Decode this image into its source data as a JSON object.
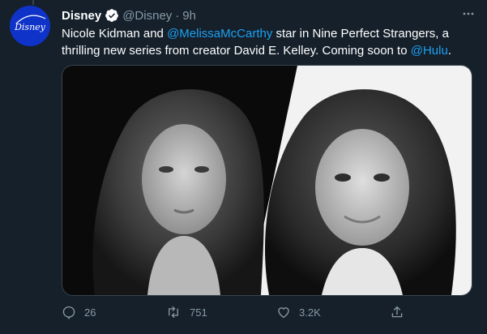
{
  "tweet": {
    "author": {
      "name": "Disney",
      "handle": "@Disney",
      "separator": "·",
      "time": "9h",
      "avatar_logo_text": "Disney",
      "verified_icon": "verified-badge-icon"
    },
    "text": {
      "part1": "Nicole Kidman and ",
      "mention1": "@MelissaMcCarthy",
      "part2": " star in Nine Perfect Strangers, a thrilling new series from creator David E. Kelley. Coming soon to ",
      "mention2": "@Hulu",
      "part3": "."
    },
    "media": {
      "icon": "photo"
    },
    "actions": {
      "reply_count": "26",
      "retweet_count": "751",
      "like_count": "3.2K"
    }
  },
  "colors": {
    "background": "#15202b",
    "accent": "#1da1f2",
    "muted": "#8899a6",
    "avatar": "#0f33c9"
  }
}
